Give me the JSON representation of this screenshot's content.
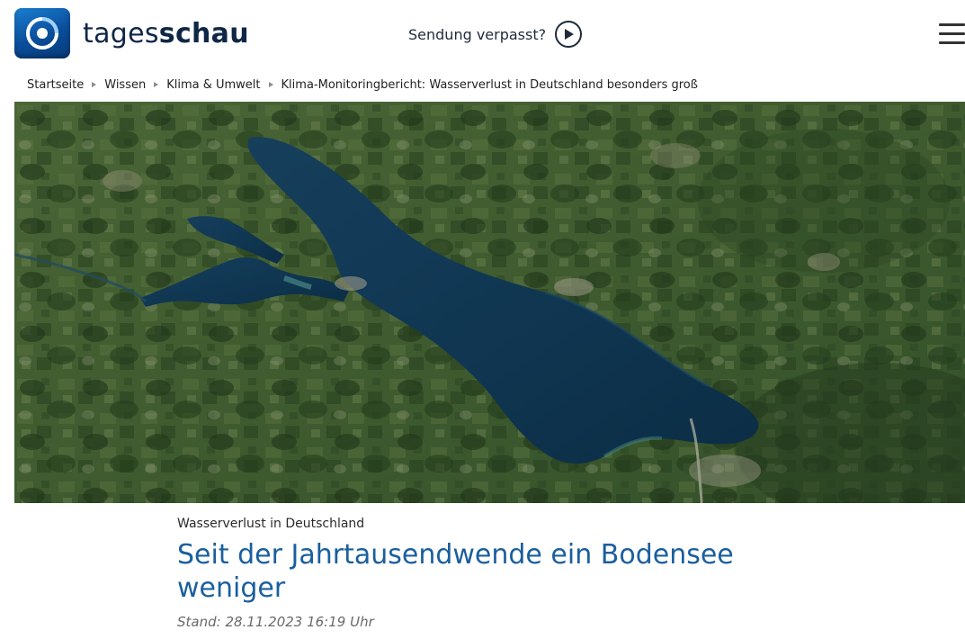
{
  "header": {
    "logo_light": "tages",
    "logo_bold": "schau",
    "sendung_label": "Sendung verpasst?",
    "icons": [
      "tagesschau-logo-icon",
      "play-icon",
      "hamburger-menu-icon"
    ]
  },
  "breadcrumb": {
    "items": [
      "Startseite",
      "Wissen",
      "Klima & Umwelt",
      "Klima-Monitoringbericht: Wasserverlust in Deutschland besonders groß"
    ]
  },
  "article": {
    "topline": "Wasserverlust in Deutschland",
    "headline": "Seit der Jahrtausendwende ein Bodensee weniger",
    "stand": "Stand: 28.11.2023 16:19 Uhr"
  },
  "colors": {
    "headline": "#1a5f9e",
    "logo_blue": "#0a4d9a",
    "lake": "#0f3550",
    "land": "#3d5a2e"
  }
}
